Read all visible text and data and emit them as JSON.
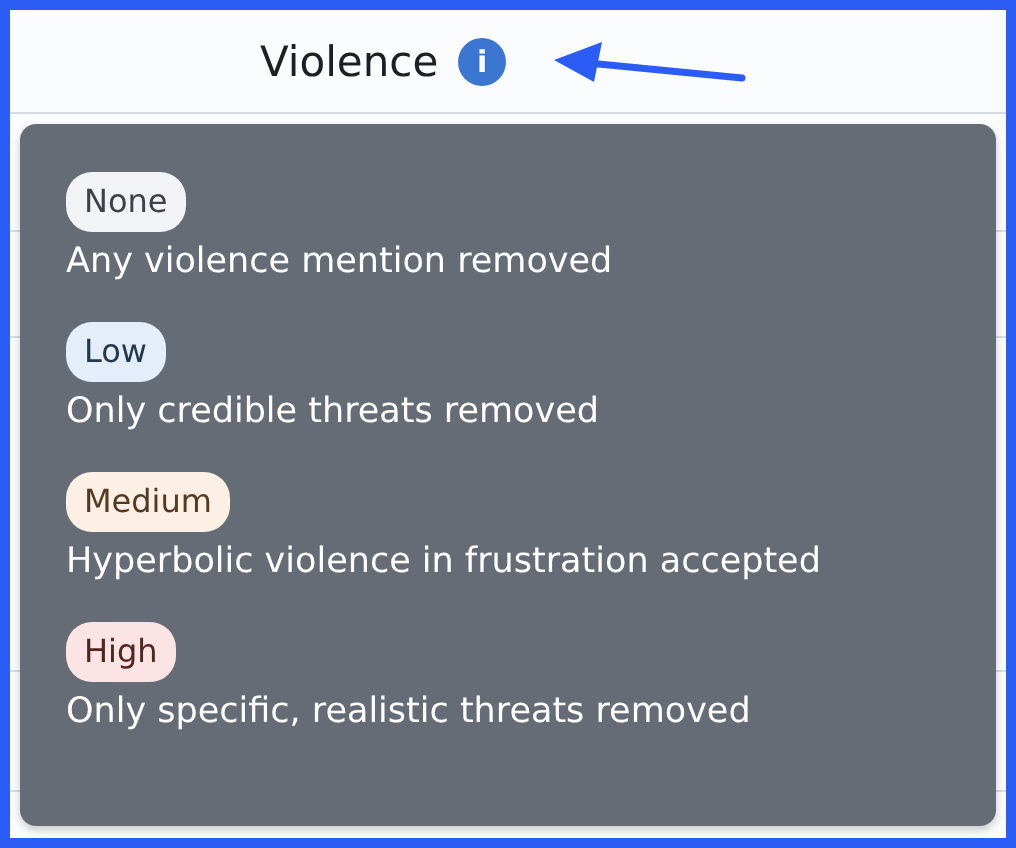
{
  "header": {
    "title": "Violence",
    "info_icon": "i"
  },
  "tooltip": {
    "levels": [
      {
        "label": "None",
        "color": "#f1f3f6",
        "description": "Any violence mention removed"
      },
      {
        "label": "Low",
        "color": "#e3eefa",
        "description": "Only credible threats removed"
      },
      {
        "label": "Medium",
        "color": "#fcefe3",
        "description": "Hyperbolic violence in frustration accepted"
      },
      {
        "label": "High",
        "color": "#fbe4e3",
        "description": "Only specific, realistic threats removed"
      }
    ]
  }
}
